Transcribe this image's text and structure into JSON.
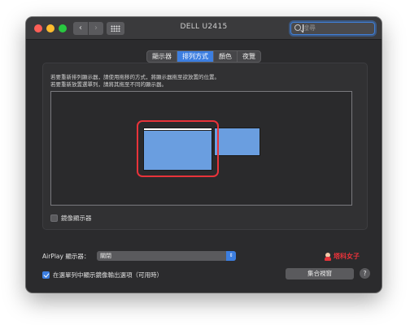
{
  "window": {
    "title": "DELL U2415"
  },
  "toolbar": {
    "back_icon": "‹",
    "forward_icon": "›",
    "grid_icon": "grid-icon"
  },
  "search": {
    "placeholder": "搜尋"
  },
  "tabs": [
    {
      "label": "顯示器",
      "active": false
    },
    {
      "label": "排列方式",
      "active": true
    },
    {
      "label": "顏色",
      "active": false
    },
    {
      "label": "夜覽",
      "active": false
    }
  ],
  "arrangement": {
    "instruction_1": "若要重新排列顯示器，請使用拖移的方式，將顯示器拖至欲放置的位置。",
    "instruction_2": "若要重新放置選單列，請將其拖至不同的顯示器。",
    "mirror_label": "鏡像顯示器",
    "mirror_checked": false
  },
  "airplay": {
    "label": "AirPlay 顯示器：",
    "selected": "關閉"
  },
  "brand": {
    "text": "塔科女子"
  },
  "footer": {
    "show_mirror_label": "在選單列中顯示鏡像輸出選項（可用時）",
    "show_mirror_checked": true,
    "gather_button": "集合視窗",
    "help_button": "?"
  },
  "colors": {
    "accent": "#3c7ee0",
    "display_fill": "#6a9ee0",
    "highlight": "#e8333a",
    "window_bg": "#2b2b2d"
  }
}
